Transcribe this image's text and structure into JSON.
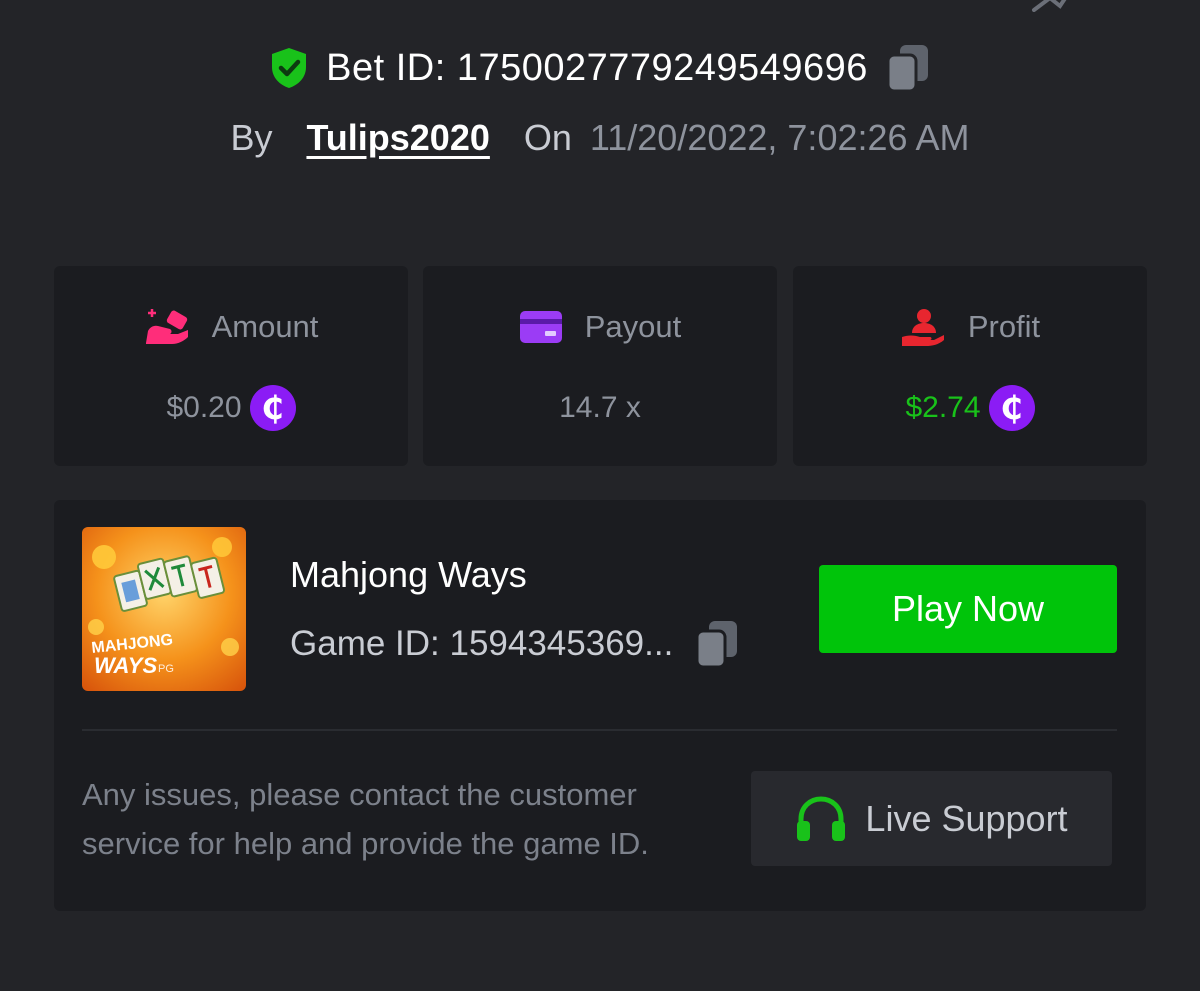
{
  "bet": {
    "id_label": "Bet ID: 1750027779249549696",
    "by_label": "By",
    "username": "Tulips2020",
    "on_label": "On",
    "datetime": "11/20/2022, 7:02:26 AM"
  },
  "stats": [
    {
      "label": "Amount",
      "value": "$0.20",
      "icon": "hand-coins-icon",
      "color": "#ff2d7a"
    },
    {
      "label": "Payout",
      "value": "14.7 x",
      "icon": "card-icon",
      "color": "#9b3cf5"
    },
    {
      "label": "Profit",
      "value": "$2.74",
      "icon": "hand-user-icon",
      "color": "#e8262f"
    }
  ],
  "coin_symbol": "₵",
  "game": {
    "title": "Mahjong Ways",
    "id_label": "Game ID: 1594345369...",
    "thumb_line1": "MAHJONG",
    "thumb_line2": "WAYS",
    "thumb_brand": "PG",
    "play_label": "Play Now"
  },
  "support": {
    "notice": "Any issues, please contact the customer service for help and provide the game ID.",
    "button_label": "Live Support"
  },
  "colors": {
    "background": "#232428",
    "card": "#1b1c20",
    "green": "#00c40a",
    "profit_text": "#19c21a",
    "coin": "#8b1cf5",
    "muted": "#8e939d"
  }
}
